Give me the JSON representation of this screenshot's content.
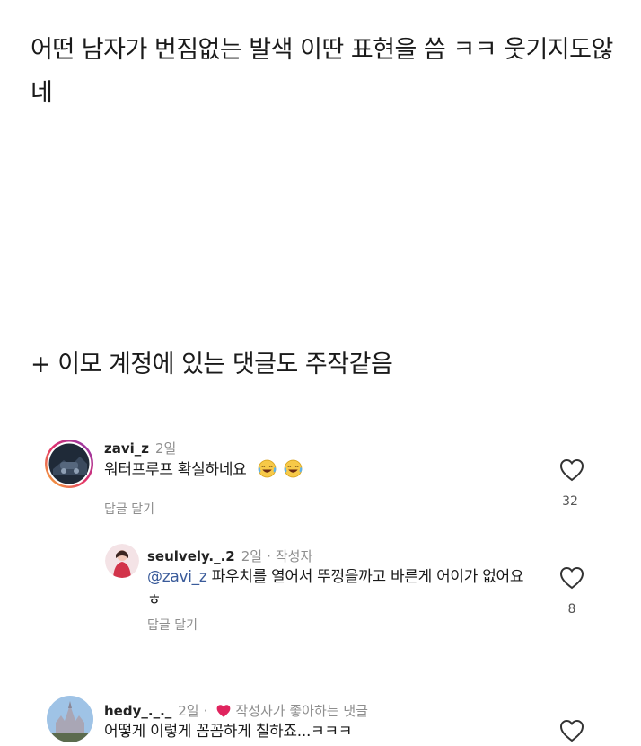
{
  "post": {
    "text": "어떤 남자가 번짐없는 발색 이딴 표현을 씀 ㅋㅋ 웃기지도않네",
    "note": "+ 이모 계정에 있는 댓글도 주작같음"
  },
  "comments": [
    {
      "username": "zavi_z",
      "time": "2일",
      "text": "워터프루프 확실하네요",
      "emoji": "😂😂",
      "reply_label": "답글 달기",
      "likes": "32"
    },
    {
      "username": "seulvely._.2",
      "time": "2일",
      "author_badge": "작성자",
      "separator": "·",
      "mention": "@zavi_z",
      "text": "파우치를 열어서 뚜껑을까고 바른게 어이가 없어요 ㅎ",
      "reply_label": "답글 달기",
      "likes": "8"
    },
    {
      "username": "hedy_._._",
      "time": "2일",
      "separator": "·",
      "liked_by": "작성자가 좋아하는 댓글",
      "text": "어떻게 이렇게 꼼꼼하게 칠하죠...ㅋㅋㅋ"
    }
  ],
  "colors": {
    "muted": "#8e8e8e",
    "heart_red": "#e0245e",
    "mention": "#3a5b9a"
  },
  "icons": {
    "like": "heart-outline-icon",
    "liked_by_author": "heart-filled-icon",
    "laugh": "tears-of-joy-emoji"
  }
}
